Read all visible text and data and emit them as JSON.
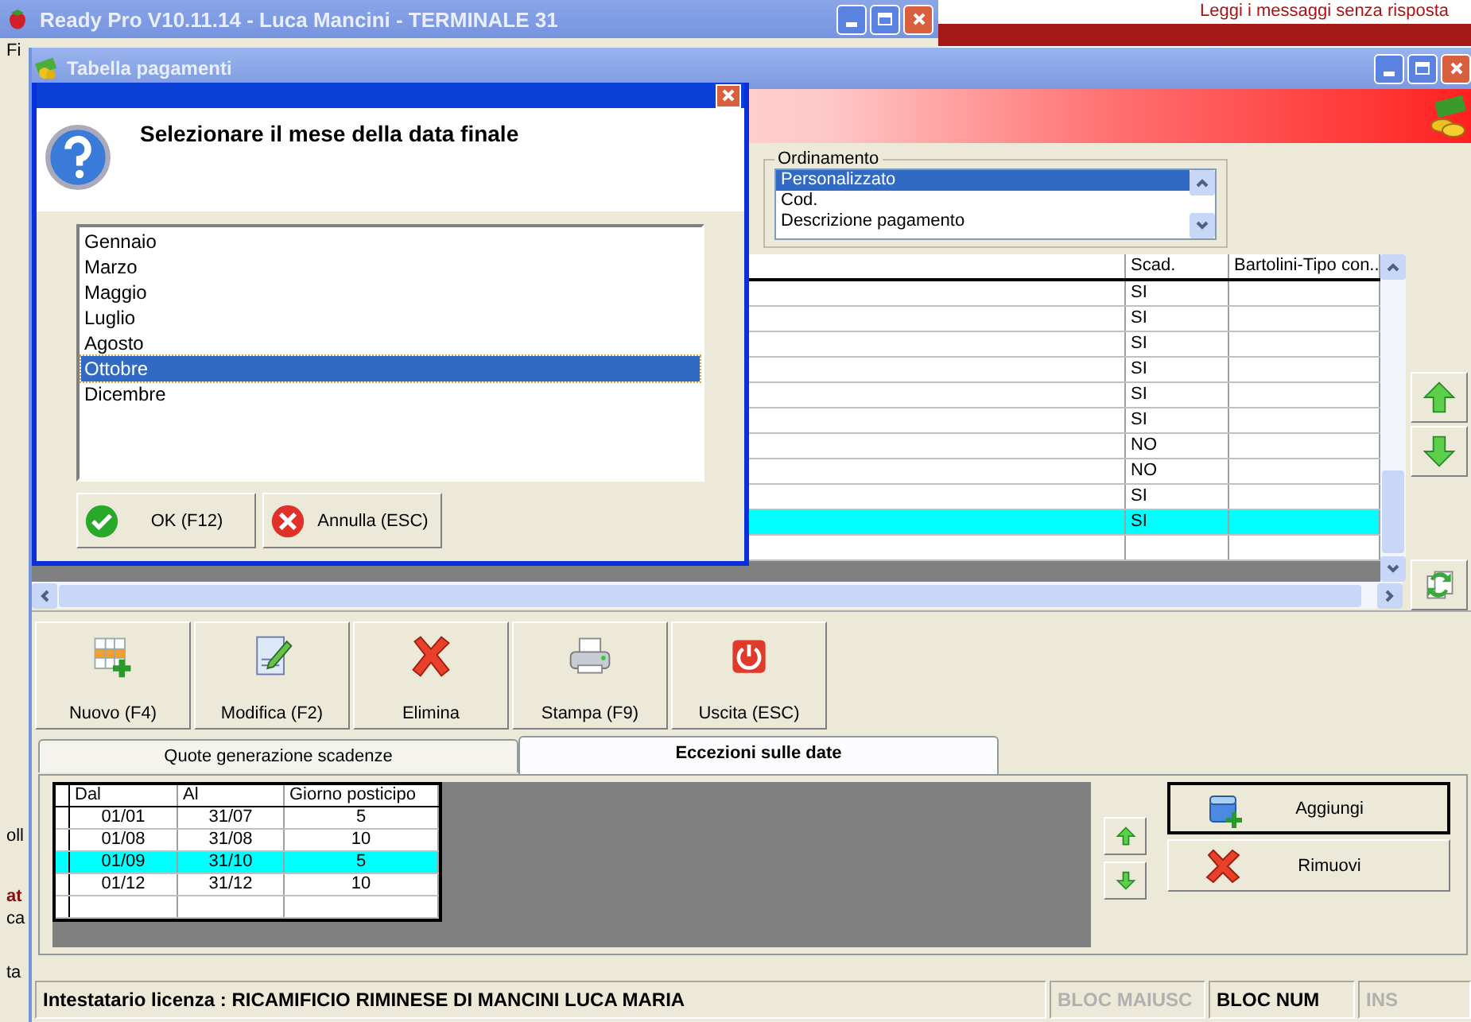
{
  "background_window": {
    "title": "Ready Pro V10.11.14 - Luca Mancini - TERMINALE 31",
    "menu_fragment": "Fi",
    "side_fragments": [
      "oll",
      "at",
      "ca",
      "ta"
    ],
    "notice": "Leggi i messaggi senza risposta"
  },
  "window": {
    "title": "Tabella pagamenti",
    "ordering": {
      "label": "Ordinamento",
      "items": [
        {
          "label": "Personalizzato",
          "selected": true
        },
        {
          "label": "Cod.",
          "selected": false
        },
        {
          "label": "Descrizione pagamento",
          "selected": false
        }
      ]
    },
    "grid": {
      "columns": [
        "Scad.",
        "Bartolini-Tipo con.."
      ],
      "rows": [
        {
          "scad": "SI",
          "selected": false
        },
        {
          "scad": "SI",
          "selected": false
        },
        {
          "scad": "SI",
          "selected": false
        },
        {
          "scad": "SI",
          "selected": false
        },
        {
          "scad": "SI",
          "selected": false
        },
        {
          "scad": "SI",
          "selected": false
        },
        {
          "scad": "NO",
          "selected": false
        },
        {
          "scad": "NO",
          "selected": false
        },
        {
          "scad": "SI",
          "selected": false
        },
        {
          "scad": "SI",
          "selected": true
        }
      ]
    },
    "toolbar": [
      {
        "label": "Nuovo (F4)",
        "kind": "new"
      },
      {
        "label": "Modifica (F2)",
        "kind": "edit"
      },
      {
        "label": "Elimina",
        "kind": "delete"
      },
      {
        "label": "Stampa (F9)",
        "kind": "print"
      },
      {
        "label": "Uscita (ESC)",
        "kind": "exit"
      }
    ],
    "tabs": [
      {
        "label": "Quote generazione scadenze",
        "selected": false
      },
      {
        "label": "Eccezioni sulle date",
        "selected": true
      }
    ],
    "exceptions": {
      "columns": [
        "Dal",
        "Al",
        "Giorno posticipo"
      ],
      "rows": [
        {
          "cells": [
            "01/01",
            "31/07",
            "5"
          ],
          "selected": false
        },
        {
          "cells": [
            "01/08",
            "31/08",
            "10"
          ],
          "selected": false
        },
        {
          "cells": [
            "01/09",
            "31/10",
            "5"
          ],
          "selected": true
        },
        {
          "cells": [
            "01/12",
            "31/12",
            "10"
          ],
          "selected": false
        }
      ]
    },
    "side_buttons": [
      {
        "label": "Aggiungi",
        "kind": "add"
      },
      {
        "label": "Rimuovi",
        "kind": "remove"
      }
    ],
    "status_bar": {
      "license": "Intestatario licenza : RICAMIFICIO RIMINESE DI MANCINI LUCA MARIA",
      "indicators": [
        {
          "label": "BLOC MAIUSC",
          "on": false
        },
        {
          "label": "BLOC NUM",
          "on": true
        },
        {
          "label": "INS",
          "on": false
        }
      ]
    }
  },
  "dialog": {
    "question": "Selezionare il mese della data finale",
    "months": [
      {
        "label": "Gennaio",
        "selected": false
      },
      {
        "label": "Marzo",
        "selected": false
      },
      {
        "label": "Maggio",
        "selected": false
      },
      {
        "label": "Luglio",
        "selected": false
      },
      {
        "label": "Agosto",
        "selected": false
      },
      {
        "label": "Ottobre",
        "selected": true
      },
      {
        "label": "Dicembre",
        "selected": false
      }
    ],
    "buttons": [
      {
        "label": "OK (F12)",
        "kind": "ok"
      },
      {
        "label": "Annulla (ESC)",
        "kind": "cancel"
      }
    ]
  }
}
